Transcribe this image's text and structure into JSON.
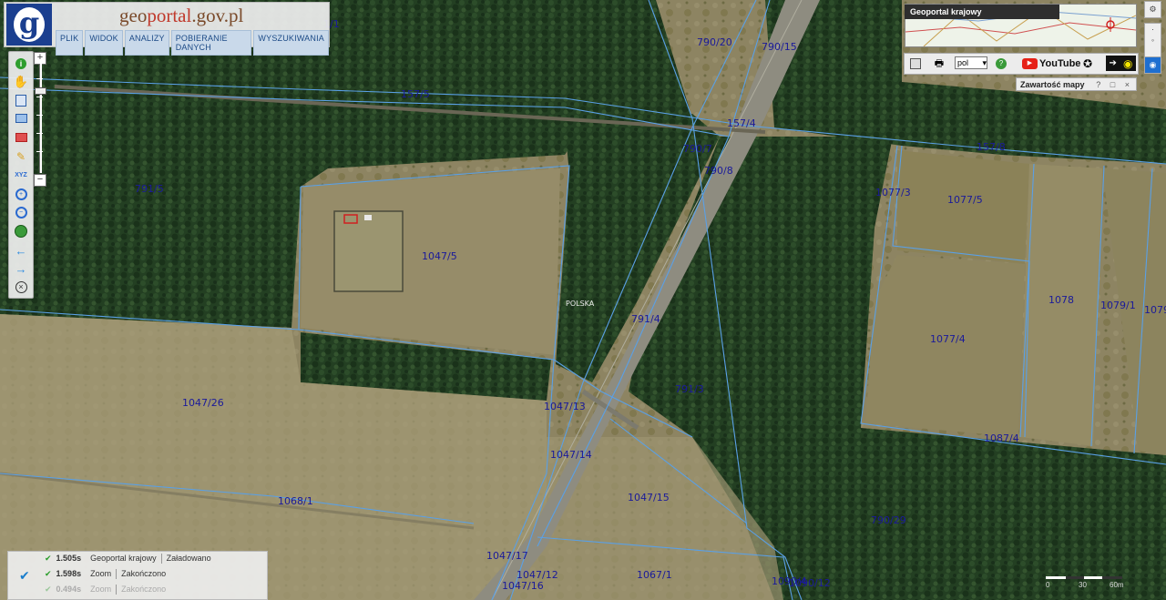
{
  "header": {
    "title_prefix": "geo",
    "title_highlight": "portal",
    "title_suffix": ".gov.pl",
    "logo_letter": "g",
    "menu": [
      "PLIK",
      "WIDOK",
      "ANALIZY",
      "POBIERANIE DANYCH",
      "WYSZUKIWANIA"
    ]
  },
  "overview": {
    "title": "Geoportal krajowy"
  },
  "toolbar2": {
    "lang": "pol",
    "youtube_label": "YouTube"
  },
  "map_content": {
    "title": "Zawartość mapy",
    "controls": "? □ ×"
  },
  "map": {
    "place_label": "POLSKA",
    "parcels": [
      "1/1",
      "790/20",
      "790/15",
      "157/5",
      "157/4",
      "157/8",
      "790/7",
      "790/8",
      "791/5",
      "1077/3",
      "1077/5",
      "1047/5",
      "791/4",
      "1078",
      "1079/1",
      "1079",
      "1077/4",
      "791/3",
      "1047/26",
      "1047/13",
      "1047/14",
      "1087/4",
      "1047/15",
      "1068/1",
      "790/29",
      "1047/17",
      "1067/1",
      "1047/12",
      "1047/16",
      "1090/4",
      "1090/12"
    ],
    "colors": {
      "parcel_line": "#5aa0e6",
      "parcel_label": "#1a1a9a",
      "road": "#8e8c80",
      "forest": "#1f3a1e",
      "field": "#8a8260"
    }
  },
  "status": {
    "rows": [
      {
        "time": "1.505s",
        "service": "Geoportal krajowy",
        "state": "Załadowano"
      },
      {
        "time": "1.598s",
        "service": "Zoom",
        "state": "Zakończono"
      },
      {
        "time": "0.494s",
        "service": "Zoom",
        "state": "Zakończono"
      }
    ]
  },
  "scale": {
    "labels": [
      "0",
      "30",
      "60m"
    ]
  }
}
